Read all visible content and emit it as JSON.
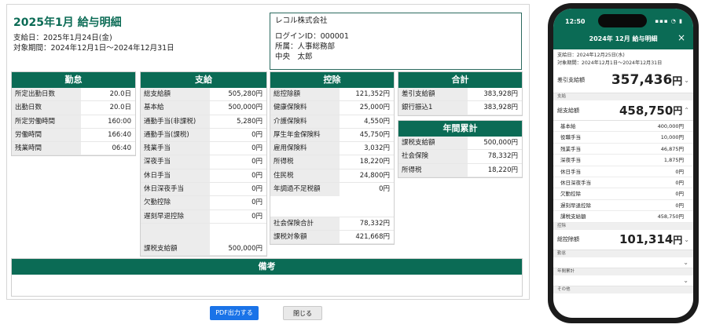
{
  "header": {
    "title": "2025年1月 給与明細",
    "pay_date": "支給日：2025年1月24日(金)",
    "period": "対象期間：2024年12月1日〜2024年12月31日"
  },
  "company": {
    "name": "レコル株式会社",
    "login": "ログインID：000001",
    "dept": "所属：人事総務部",
    "employee": "中央　太郎"
  },
  "kintai": {
    "title": "勤怠",
    "rows": [
      {
        "label": "所定出勤日数",
        "value": "20.0日"
      },
      {
        "label": "出勤日数",
        "value": "20.0日"
      },
      {
        "label": "所定労働時間",
        "value": "160:00"
      },
      {
        "label": "労働時間",
        "value": "166:40"
      },
      {
        "label": "残業時間",
        "value": "06:40"
      }
    ]
  },
  "shikyu": {
    "title": "支給",
    "rows": [
      {
        "label": "総支給額",
        "value": "505,280円"
      },
      {
        "label": "基本給",
        "value": "500,000円"
      },
      {
        "label": "通勤手当(非課税)",
        "value": "5,280円"
      },
      {
        "label": "通勤手当(課税)",
        "value": "0円"
      },
      {
        "label": "残業手当",
        "value": "0円"
      },
      {
        "label": "深夜手当",
        "value": "0円"
      },
      {
        "label": "休日手当",
        "value": "0円"
      },
      {
        "label": "休日深夜手当",
        "value": "0円"
      },
      {
        "label": "欠勤控除",
        "value": "0円"
      },
      {
        "label": "遅刻早退控除",
        "value": "0円"
      }
    ],
    "total": {
      "label": "課税支給額",
      "value": "500,000円"
    }
  },
  "kojo": {
    "title": "控除",
    "rows": [
      {
        "label": "総控除額",
        "value": "121,352円"
      },
      {
        "label": "健康保険料",
        "value": "25,000円"
      },
      {
        "label": "介護保険料",
        "value": "4,550円"
      },
      {
        "label": "厚生年金保険料",
        "value": "45,750円"
      },
      {
        "label": "雇用保険料",
        "value": "3,032円"
      },
      {
        "label": "所得税",
        "value": "18,220円"
      },
      {
        "label": "住民税",
        "value": "24,800円"
      },
      {
        "label": "年調過不足税額",
        "value": "0円"
      }
    ],
    "totals": [
      {
        "label": "社会保険合計",
        "value": "78,332円"
      },
      {
        "label": "課税対象額",
        "value": "421,668円"
      }
    ]
  },
  "gokei": {
    "title": "合計",
    "rows": [
      {
        "label": "差引支給額",
        "value": "383,928円"
      },
      {
        "label": "銀行振込1",
        "value": "383,928円"
      }
    ]
  },
  "nenkan": {
    "title": "年間累計",
    "rows": [
      {
        "label": "課税支給額",
        "value": "500,000円"
      },
      {
        "label": "社会保険",
        "value": "78,332円"
      },
      {
        "label": "所得税",
        "value": "18,220円"
      }
    ]
  },
  "biko": {
    "title": "備考"
  },
  "buttons": {
    "pdf": "PDF出力する",
    "close": "閉じる"
  },
  "colors": {
    "accent": "#0b6b55",
    "button_primary": "#1a73e8"
  },
  "phone": {
    "time": "12:50",
    "status": "▪▪▪ ◔ ▮",
    "title": "2024年 12月 給与明細",
    "close_icon": "×",
    "pay_date": "支給日：2024年12月25日(水)",
    "period": "対象期間：2024年12月1日〜2024年12月31日",
    "net_label": "差引支給額",
    "net_amount": "357,436",
    "yen": "円",
    "shikyu_section": "支給",
    "shikyu_label": "総支給額",
    "shikyu_amount": "458,750",
    "items": [
      {
        "label": "基本給",
        "value": "400,000円"
      },
      {
        "label": "役職手当",
        "value": "10,000円"
      },
      {
        "label": "残業手当",
        "value": "46,875円"
      },
      {
        "label": "深夜手当",
        "value": "1,875円"
      },
      {
        "label": "休日手当",
        "value": "0円"
      },
      {
        "label": "休日深夜手当",
        "value": "0円"
      },
      {
        "label": "欠勤控除",
        "value": "0円"
      },
      {
        "label": "遅刻早退控除",
        "value": "0円"
      },
      {
        "label": "課税支給額",
        "value": "458,750円"
      }
    ],
    "kojo_section": "控除",
    "kojo_label": "総控除額",
    "kojo_amount": "101,314",
    "kintai_section": "勤怠",
    "nenkan_section": "年間累計",
    "other_section": "その他"
  }
}
